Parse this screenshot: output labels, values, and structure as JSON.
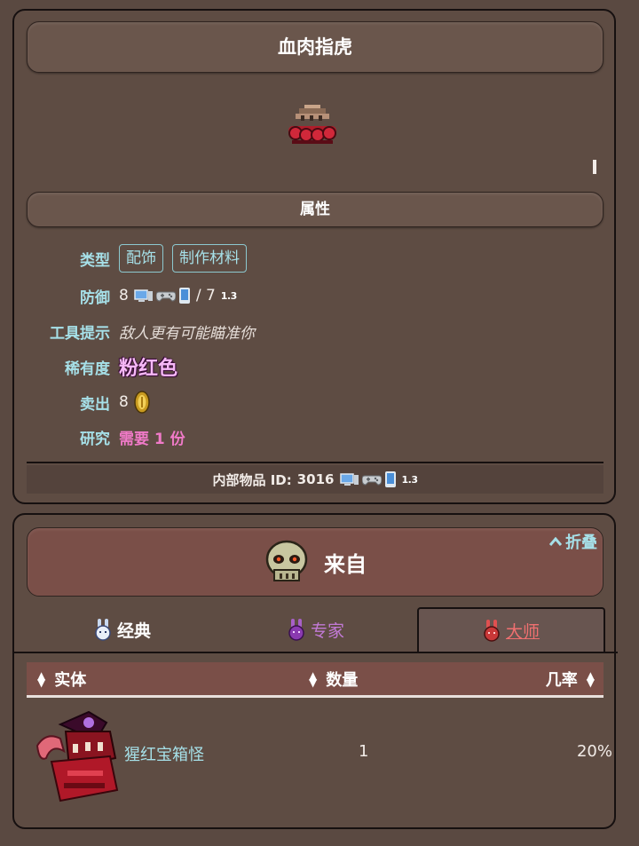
{
  "item": {
    "title": "血肉指虎",
    "attributes_header": "属性",
    "type_label": "类型",
    "type_tags": [
      "配饰",
      "制作材料"
    ],
    "defense_label": "防御",
    "defense_value": "8",
    "defense_alt": "/ 7",
    "version": "1.3",
    "tooltip_label": "工具提示",
    "tooltip_value": "敌人更有可能瞄准你",
    "rarity_label": "稀有度",
    "rarity_value": "粉红色",
    "sell_label": "卖出",
    "sell_value": "8",
    "research_label": "研究",
    "research_value": "需要 1 份",
    "internal_id_label": "内部物品 ID:",
    "internal_id_value": "3016"
  },
  "source": {
    "banner_label": "来自",
    "collapse_label": "折叠",
    "tabs": [
      {
        "label": "经典",
        "state": "normal"
      },
      {
        "label": "专家",
        "state": "normal"
      },
      {
        "label": "大师",
        "state": "selected"
      }
    ],
    "table": {
      "headers": [
        "实体",
        "数量",
        "几率"
      ],
      "rows": [
        {
          "entity": "猩红宝箱怪",
          "quantity": "1",
          "rate": "20%"
        }
      ]
    }
  },
  "icons": {
    "devices": [
      "desktop-icon",
      "gamepad-icon",
      "mobile-icon"
    ],
    "coin": "gold-coin-icon",
    "skull": "skull-icon",
    "bunnies": [
      "classic-bunny-icon",
      "expert-bunny-icon",
      "master-bunny-icon"
    ]
  },
  "colors": {
    "label_cyan": "#a6e0e8",
    "rarity_pink": "#f6b8f6",
    "research_pink": "#f07ac8",
    "master_red": "#f07070",
    "expert_purple": "#c27ad6"
  }
}
